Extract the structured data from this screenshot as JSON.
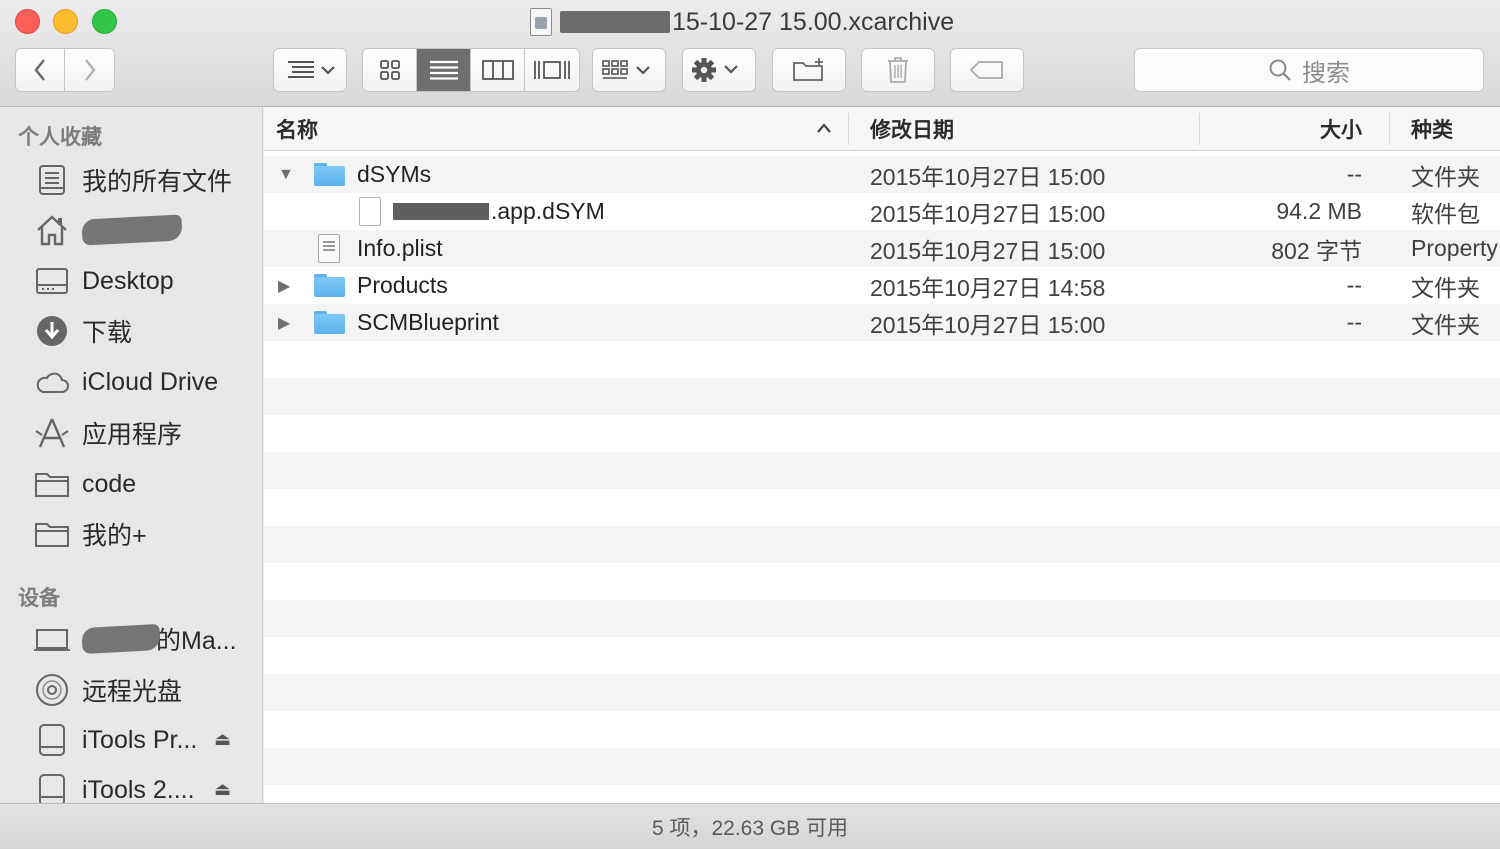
{
  "window": {
    "title_suffix": "15-10-27 15.00.xcarchive"
  },
  "toolbar": {
    "search_placeholder": "搜索"
  },
  "sidebar": {
    "favorites_header": "个人收藏",
    "favorites": [
      {
        "label": "我的所有文件",
        "icon": "all-files-icon"
      },
      {
        "label": "",
        "icon": "home-icon"
      },
      {
        "label": "Desktop",
        "icon": "desktop-icon"
      },
      {
        "label": "下载",
        "icon": "download-icon"
      },
      {
        "label": "iCloud Drive",
        "icon": "cloud-icon"
      },
      {
        "label": "应用程序",
        "icon": "applications-icon"
      },
      {
        "label": "code",
        "icon": "folder-icon"
      },
      {
        "label": "我的+",
        "icon": "folder-icon"
      }
    ],
    "devices_header": "设备",
    "devices": [
      {
        "label": "的Ma...",
        "icon": "laptop-icon"
      },
      {
        "label": "远程光盘",
        "icon": "disc-icon"
      },
      {
        "label": "iTools Pr...",
        "icon": "drive-icon"
      },
      {
        "label": "iTools 2....",
        "icon": "drive-icon"
      }
    ]
  },
  "columns": {
    "name": "名称",
    "date": "修改日期",
    "size": "大小",
    "kind": "种类"
  },
  "files": [
    {
      "name": "dSYMs",
      "date": "2015年10月27日 15:00",
      "size": "--",
      "kind": "文件夹",
      "type": "folder",
      "expanded": true,
      "indent": 0
    },
    {
      "name": ".app.dSYM",
      "date": "2015年10月27日 15:00",
      "size": "94.2 MB",
      "kind": "软件包",
      "type": "doc",
      "indent": 1
    },
    {
      "name": "Info.plist",
      "date": "2015年10月27日 15:00",
      "size": "802 字节",
      "kind": "Property",
      "type": "plist",
      "indent": 0
    },
    {
      "name": "Products",
      "date": "2015年10月27日 14:58",
      "size": "--",
      "kind": "文件夹",
      "type": "folder",
      "expanded": false,
      "indent": 0
    },
    {
      "name": "SCMBlueprint",
      "date": "2015年10月27日 15:00",
      "size": "--",
      "kind": "文件夹",
      "type": "folder",
      "expanded": false,
      "indent": 0
    }
  ],
  "status": {
    "text": "5 项，22.63 GB 可用"
  }
}
